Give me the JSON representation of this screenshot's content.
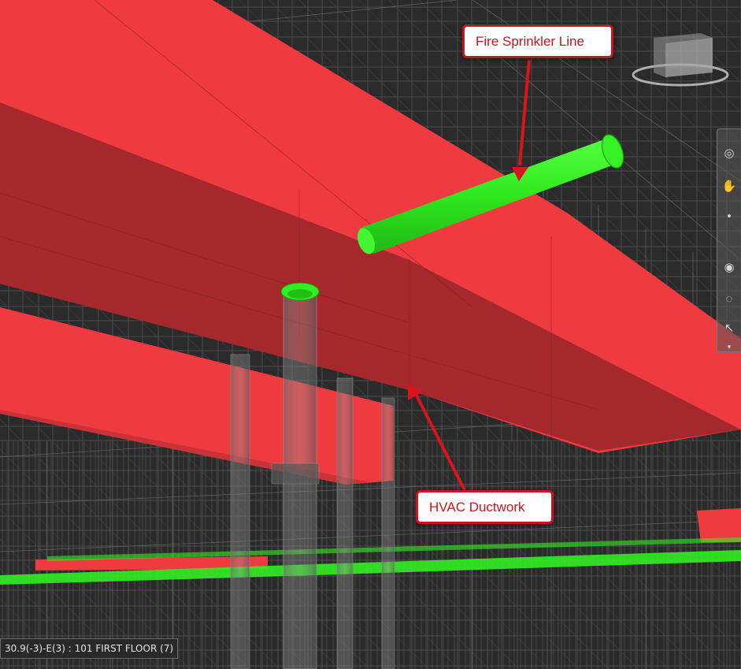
{
  "callouts": {
    "sprinkler": "Fire Sprinkler Line",
    "hvac": "HVAC Ductwork"
  },
  "status_bar": {
    "text": "30.9(-3)-E(3) : 101 FIRST FLOOR (7)"
  },
  "colors": {
    "duct_red": "#ef3b40",
    "duct_dark": "#a82a2c",
    "pipe_green": "#33ee22",
    "callout_border": "#c8141c",
    "background": "#262626"
  },
  "navigation_bar": {
    "icons": [
      "steering-wheel-icon",
      "pan-icon",
      "zoom-icon",
      "orbit-icon",
      "look-icon",
      "select-icon",
      "expand-icon"
    ]
  }
}
